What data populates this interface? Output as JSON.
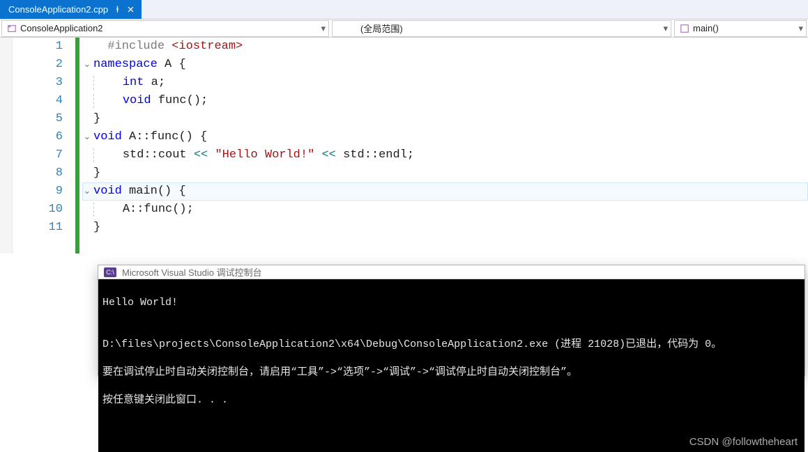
{
  "tab": {
    "filename": "ConsoleApplication2.cpp"
  },
  "nav": {
    "scope_project": "ConsoleApplication2",
    "scope_global": "(全局范围)",
    "scope_function": "main()"
  },
  "lines": [
    "1",
    "2",
    "3",
    "4",
    "5",
    "6",
    "7",
    "8",
    "9",
    "10",
    "11"
  ],
  "code": {
    "l1_pp": "#include",
    "l1_inc": "<iostream>",
    "l2_kw": "namespace",
    "l2_name": "A",
    "l2_brace": "{",
    "l3_kw": "int",
    "l3_id": "a",
    "l3_semi": ";",
    "l4_kw": "void",
    "l4_fn": "func",
    "l4_paren": "()",
    "l4_semi": ";",
    "l5_brace": "}",
    "l6_kw": "void",
    "l6_ns": "A",
    "l6_sep": "::",
    "l6_fn": "func",
    "l6_paren": "()",
    "l6_brace": "{",
    "l7_std": "std",
    "l7_sep1": "::",
    "l7_cout": "cout",
    "l7_op1": "<<",
    "l7_str": "\"Hello World!\"",
    "l7_op2": "<<",
    "l7_std2": "std",
    "l7_sep2": "::",
    "l7_endl": "endl",
    "l7_semi": ";",
    "l8_brace": "}",
    "l9_kw": "void",
    "l9_fn": "main",
    "l9_paren": "()",
    "l9_brace": "{",
    "l10_ns": "A",
    "l10_sep": "::",
    "l10_fn": "func",
    "l10_paren": "()",
    "l10_semi": ";",
    "l11_brace": "}"
  },
  "console": {
    "title": "Microsoft Visual Studio 调试控制台",
    "line1": "Hello World!",
    "blank": "",
    "line2": "D:\\files\\projects\\ConsoleApplication2\\x64\\Debug\\ConsoleApplication2.exe (进程 21028)已退出，代码为 0。",
    "line3": "要在调试停止时自动关闭控制台，请启用“工具”->“选项”->“调试”->“调试停止时自动关闭控制台”。",
    "line4": "按任意键关闭此窗口. . ."
  },
  "watermark": "CSDN @followtheheart"
}
